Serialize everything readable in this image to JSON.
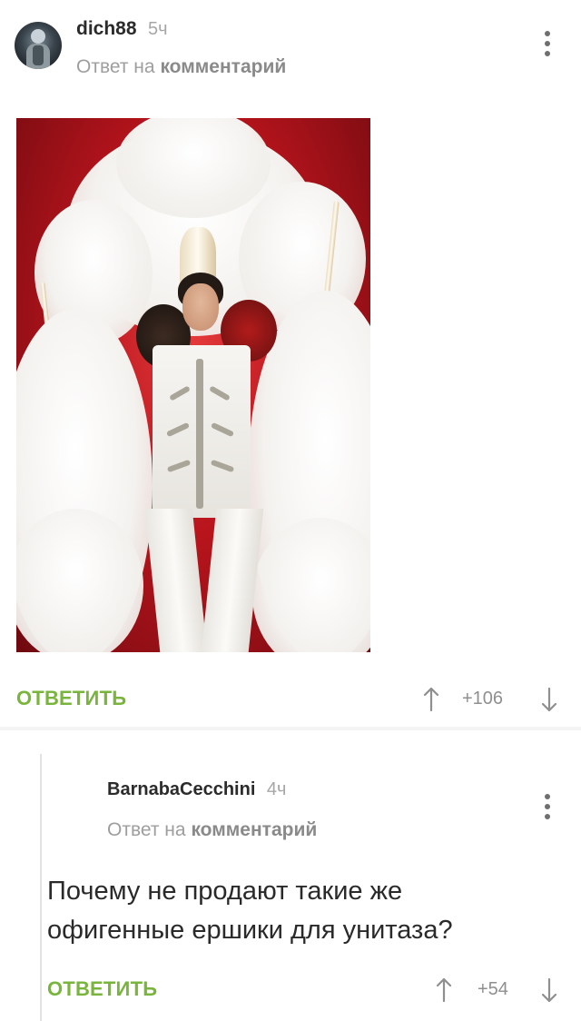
{
  "comment1": {
    "username": "dich88",
    "time": "5ч",
    "reply_prefix": "Ответ на",
    "reply_target": "комментарий",
    "reply_button": "ОТВЕТИТЬ",
    "rating": "+106"
  },
  "comment2": {
    "username": "BarnabaCecchini",
    "time": "4ч",
    "reply_prefix": "Ответ на",
    "reply_target": "комментарий",
    "text_line1": "Почему не продают такие же",
    "text_line2": "офигенные ершики для унитаза?",
    "reply_button": "ОТВЕТИТЬ",
    "rating": "+54"
  },
  "colors": {
    "accent_green": "#79b53c",
    "muted_text": "#9e9e9e",
    "photo_background": "#b8141c"
  },
  "icons": [
    "avatar",
    "kebab-menu-icon",
    "arrow-up-icon",
    "arrow-down-icon"
  ]
}
